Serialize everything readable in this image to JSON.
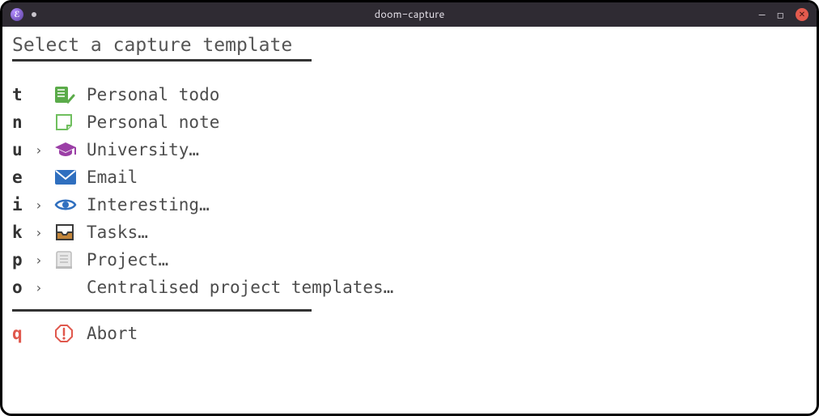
{
  "window": {
    "title": "doom-capture"
  },
  "heading": "Select a capture template",
  "items": [
    {
      "key": "t",
      "submenu": false,
      "icon": "todo-check-icon",
      "label": "Personal todo"
    },
    {
      "key": "n",
      "submenu": false,
      "icon": "note-icon",
      "label": "Personal note"
    },
    {
      "key": "u",
      "submenu": true,
      "icon": "graduation-icon",
      "label": "University…"
    },
    {
      "key": "e",
      "submenu": false,
      "icon": "envelope-icon",
      "label": "Email"
    },
    {
      "key": "i",
      "submenu": true,
      "icon": "eye-icon",
      "label": "Interesting…"
    },
    {
      "key": "k",
      "submenu": true,
      "icon": "inbox-icon",
      "label": "Tasks…"
    },
    {
      "key": "p",
      "submenu": true,
      "icon": "project-icon",
      "label": "Project…"
    },
    {
      "key": "o",
      "submenu": true,
      "icon": "",
      "label": "Centralised project templates…"
    }
  ],
  "abort": {
    "key": "q",
    "icon": "abort-icon",
    "label": "Abort"
  },
  "colors": {
    "todo": "#5bab4a",
    "note_fill": "#ffffff",
    "note_stroke": "#6fbf5e",
    "university": "#9b3fa6",
    "email": "#2f6fbf",
    "eye": "#2f6fbf",
    "inbox_frame": "#3a3a3a",
    "inbox_fill": "#c2853a",
    "project": "#cfcfcf",
    "abort_stroke": "#e0584d"
  }
}
